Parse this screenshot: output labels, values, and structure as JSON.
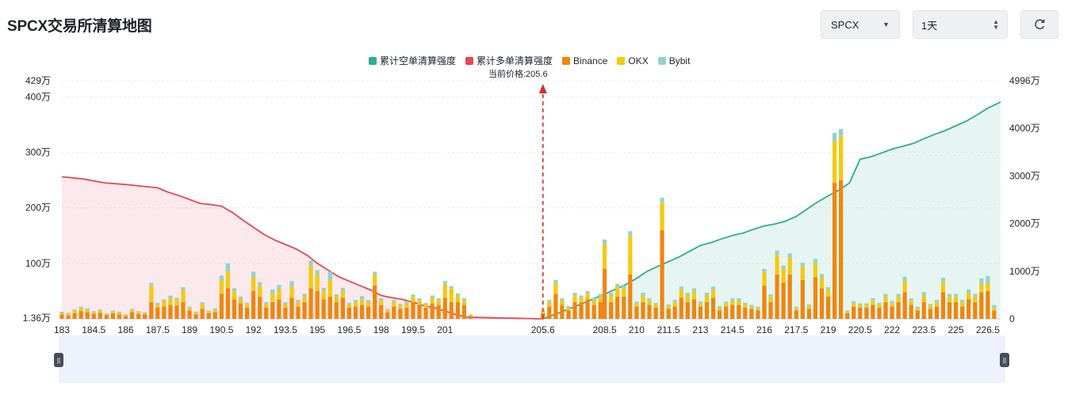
{
  "header": {
    "title": "SPCX交易所清算地图",
    "symbol_select": "SPCX",
    "range_select": "1天",
    "refresh_icon": "refresh-icon"
  },
  "price_label": "当前价格:205.6",
  "colors": {
    "short": "#2ead8f",
    "long": "#e54857",
    "binance": "#f0850f",
    "okx": "#f6c90e",
    "bybit": "#8fd3d0",
    "price_line": "#d92b2b"
  },
  "chart_data": {
    "type": "bar",
    "title": "",
    "legend": [
      "累计空单清算强度",
      "累计多单清算强度",
      "Binance",
      "OKX",
      "Bybit"
    ],
    "legend_position": "top-center",
    "current_price": 205.6,
    "x_ticks": [
      "183",
      "184.5",
      "186",
      "187.5",
      "189",
      "190.5",
      "192",
      "193.5",
      "195",
      "196.5",
      "198",
      "199.5",
      "201",
      "205.6",
      "208.5",
      "210",
      "211.5",
      "213",
      "214.5",
      "216",
      "217.5",
      "219",
      "220.5",
      "222",
      "223.5",
      "225",
      "226.5"
    ],
    "y_left_ticks": [
      "1.36万",
      "100万",
      "200万",
      "300万",
      "400万",
      "429万"
    ],
    "y_right_ticks": [
      "0",
      "1000万",
      "2000万",
      "3000万",
      "4000万",
      "4996万"
    ],
    "y_left_range": [
      0,
      429
    ],
    "y_right_range": [
      0,
      4996
    ],
    "unit": "万",
    "grid": true,
    "x": [
      183,
      183.3,
      183.6,
      183.9,
      184.2,
      184.5,
      184.8,
      185.1,
      185.4,
      185.7,
      186,
      186.3,
      186.6,
      186.9,
      187.2,
      187.5,
      187.8,
      188.1,
      188.4,
      188.7,
      189,
      189.3,
      189.6,
      189.9,
      190.2,
      190.5,
      190.8,
      191.1,
      191.4,
      191.7,
      192,
      192.3,
      192.6,
      192.9,
      193.2,
      193.5,
      193.8,
      194.1,
      194.4,
      194.7,
      195,
      195.3,
      195.6,
      195.9,
      196.2,
      196.5,
      196.8,
      197.1,
      197.4,
      197.7,
      198,
      198.3,
      198.6,
      198.9,
      199.2,
      199.5,
      199.8,
      200.1,
      200.4,
      200.7,
      201,
      201.3,
      201.6,
      201.9,
      202.2,
      205.6,
      205.9,
      206.2,
      206.5,
      206.8,
      207.1,
      207.4,
      207.7,
      208,
      208.3,
      208.5,
      208.8,
      209.1,
      209.4,
      209.7,
      210,
      210.3,
      210.6,
      210.9,
      211.2,
      211.5,
      211.8,
      212.1,
      212.4,
      212.7,
      213,
      213.3,
      213.6,
      213.9,
      214.2,
      214.5,
      214.8,
      215.1,
      215.4,
      215.7,
      216,
      216.3,
      216.6,
      216.9,
      217.2,
      217.5,
      217.8,
      218.1,
      218.4,
      218.7,
      219,
      219.3,
      219.6,
      219.9,
      220.2,
      220.5,
      220.8,
      221.1,
      221.4,
      221.7,
      222,
      222.3,
      222.6,
      222.9,
      223.2,
      223.5,
      223.8,
      224.1,
      224.4,
      224.7,
      225,
      225.3,
      225.6,
      225.9,
      226.2,
      226.5,
      226.8,
      227.1
    ],
    "series": [
      {
        "name": "Binance",
        "values": [
          8,
          6,
          10,
          14,
          12,
          9,
          11,
          7,
          10,
          8,
          5,
          12,
          9,
          8,
          30,
          20,
          22,
          25,
          24,
          30,
          15,
          8,
          18,
          10,
          12,
          45,
          55,
          35,
          28,
          20,
          50,
          40,
          20,
          30,
          35,
          20,
          38,
          22,
          30,
          55,
          50,
          35,
          40,
          30,
          38,
          20,
          22,
          25,
          22,
          60,
          25,
          12,
          22,
          18,
          20,
          30,
          25,
          20,
          28,
          25,
          38,
          30,
          30,
          25,
          5,
          10,
          22,
          45,
          25,
          15,
          30,
          30,
          35,
          25,
          30,
          90,
          30,
          40,
          40,
          80,
          22,
          30,
          25,
          20,
          160,
          18,
          22,
          38,
          30,
          35,
          22,
          30,
          38,
          15,
          22,
          25,
          25,
          20,
          18,
          15,
          60,
          30,
          80,
          65,
          80,
          15,
          70,
          18,
          75,
          55,
          40,
          245,
          250,
          10,
          22,
          20,
          20,
          25,
          20,
          30,
          22,
          30,
          48,
          25,
          15,
          30,
          18,
          22,
          48,
          30,
          30,
          22,
          35,
          30,
          48,
          50,
          15
        ],
        "color": "#f0850f"
      },
      {
        "name": "OKX",
        "values": [
          3,
          3,
          5,
          5,
          4,
          3,
          4,
          2,
          3,
          3,
          2,
          4,
          3,
          2,
          30,
          6,
          10,
          12,
          10,
          22,
          4,
          3,
          8,
          3,
          4,
          25,
          30,
          15,
          8,
          6,
          25,
          20,
          6,
          15,
          18,
          6,
          20,
          8,
          10,
          40,
          30,
          15,
          30,
          10,
          12,
          6,
          8,
          10,
          8,
          20,
          8,
          4,
          8,
          6,
          8,
          10,
          8,
          6,
          10,
          8,
          25,
          25,
          12,
          8,
          2,
          4,
          8,
          20,
          8,
          5,
          12,
          8,
          10,
          8,
          10,
          45,
          12,
          18,
          15,
          70,
          6,
          12,
          8,
          6,
          50,
          5,
          8,
          15,
          12,
          15,
          6,
          12,
          15,
          5,
          6,
          8,
          8,
          6,
          4,
          4,
          25,
          10,
          35,
          25,
          30,
          4,
          25,
          5,
          25,
          20,
          12,
          75,
          80,
          3,
          6,
          5,
          5,
          8,
          6,
          10,
          6,
          10,
          20,
          8,
          4,
          12,
          6,
          8,
          18,
          10,
          10,
          8,
          12,
          10,
          15,
          15,
          5
        ],
        "color": "#f6c90e"
      },
      {
        "name": "Bybit",
        "values": [
          2,
          2,
          2,
          3,
          3,
          2,
          2,
          1,
          2,
          2,
          1,
          2,
          2,
          2,
          5,
          3,
          3,
          5,
          4,
          5,
          3,
          2,
          4,
          2,
          3,
          8,
          15,
          5,
          4,
          3,
          10,
          6,
          4,
          8,
          8,
          4,
          10,
          4,
          5,
          10,
          8,
          6,
          15,
          4,
          6,
          3,
          4,
          6,
          4,
          5,
          4,
          2,
          4,
          3,
          4,
          4,
          4,
          3,
          4,
          4,
          5,
          4,
          4,
          4,
          1,
          2,
          4,
          5,
          4,
          3,
          5,
          4,
          5,
          4,
          5,
          8,
          5,
          5,
          5,
          8,
          3,
          5,
          4,
          3,
          8,
          3,
          4,
          5,
          5,
          5,
          3,
          5,
          5,
          3,
          3,
          4,
          4,
          3,
          3,
          3,
          5,
          4,
          8,
          6,
          8,
          3,
          6,
          3,
          8,
          6,
          5,
          15,
          12,
          2,
          4,
          3,
          3,
          4,
          3,
          5,
          4,
          5,
          8,
          4,
          3,
          6,
          3,
          4,
          8,
          5,
          5,
          4,
          6,
          5,
          10,
          12,
          5
        ],
        "color": "#8fd3d0"
      }
    ],
    "cumulative_long": {
      "name": "累计多单清算强度",
      "axis": "left",
      "x": [
        183,
        184,
        185,
        186,
        187,
        187.5,
        188,
        188.5,
        189,
        189.5,
        190,
        190.5,
        191,
        191.5,
        192,
        192.5,
        193,
        193.5,
        194,
        194.5,
        195,
        195.5,
        196,
        196.5,
        197,
        197.5,
        198,
        198.5,
        199,
        199.5,
        200,
        200.5,
        201,
        201.5,
        202,
        205.6
      ],
      "values": [
        256,
        252,
        245,
        242,
        238,
        236,
        228,
        222,
        215,
        208,
        206,
        203,
        192,
        178,
        165,
        152,
        142,
        134,
        126,
        115,
        100,
        88,
        76,
        68,
        60,
        52,
        42,
        38,
        35,
        30,
        24,
        20,
        14,
        8,
        3,
        0
      ]
    },
    "cumulative_short": {
      "name": "累计空单清算强度",
      "axis": "right",
      "x": [
        205.6,
        206.5,
        207.5,
        208.5,
        209.5,
        210,
        210.5,
        211,
        211.5,
        212,
        212.5,
        213,
        213.5,
        214,
        214.5,
        215,
        215.5,
        216,
        216.5,
        217,
        217.5,
        218,
        218.5,
        219,
        219.5,
        220,
        220.5,
        221,
        221.5,
        222,
        222.5,
        223,
        223.5,
        224,
        224.5,
        225,
        225.5,
        226,
        226.5,
        227.1
      ],
      "values": [
        0,
        150,
        330,
        520,
        720,
        850,
        1000,
        1100,
        1200,
        1300,
        1420,
        1540,
        1600,
        1680,
        1750,
        1800,
        1880,
        1950,
        1990,
        2050,
        2150,
        2300,
        2450,
        2580,
        2700,
        2850,
        3350,
        3400,
        3480,
        3560,
        3620,
        3680,
        3780,
        3870,
        3950,
        4050,
        4150,
        4280,
        4420,
        4550
      ]
    }
  },
  "slider": {
    "left_handle": "drag-handle-icon",
    "right_handle": "drag-handle-icon"
  }
}
